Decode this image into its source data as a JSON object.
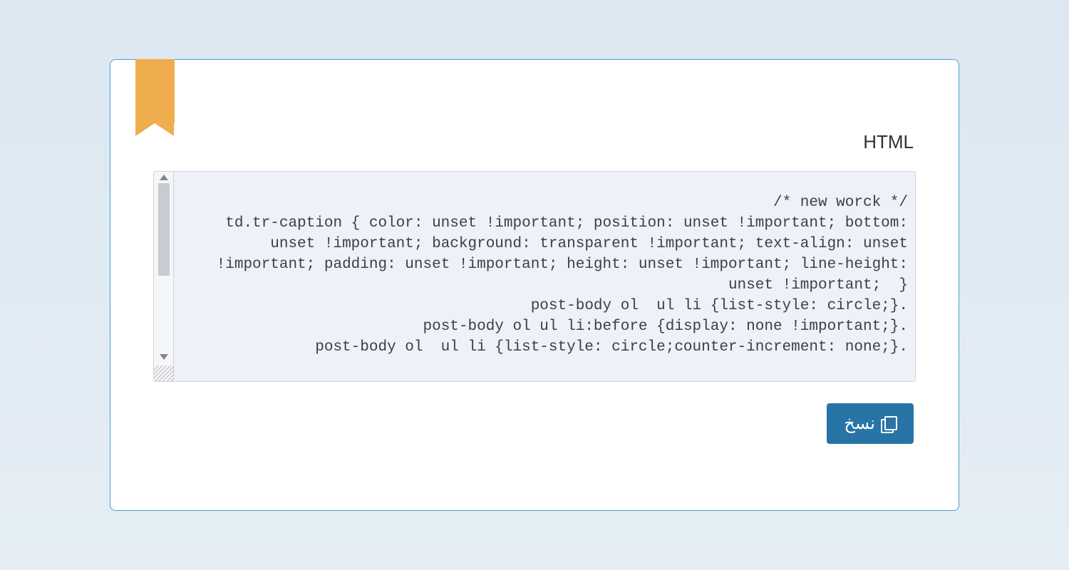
{
  "section": {
    "label": "HTML"
  },
  "code": {
    "content": "/* new worck */\ntd.tr-caption { color: unset !important; position: unset !important; bottom: unset !important; background: transparent !important; text-align: unset !important; padding: unset !important; height: unset !important; line-height: unset !important;  }\npost-body ol  ul li {list-style: circle;}.\npost-body ol ul li:before {display: none !important;}.\npost-body ol  ul li {list-style: circle;counter-increment: none;}."
  },
  "actions": {
    "copy_label": "نسخ"
  }
}
